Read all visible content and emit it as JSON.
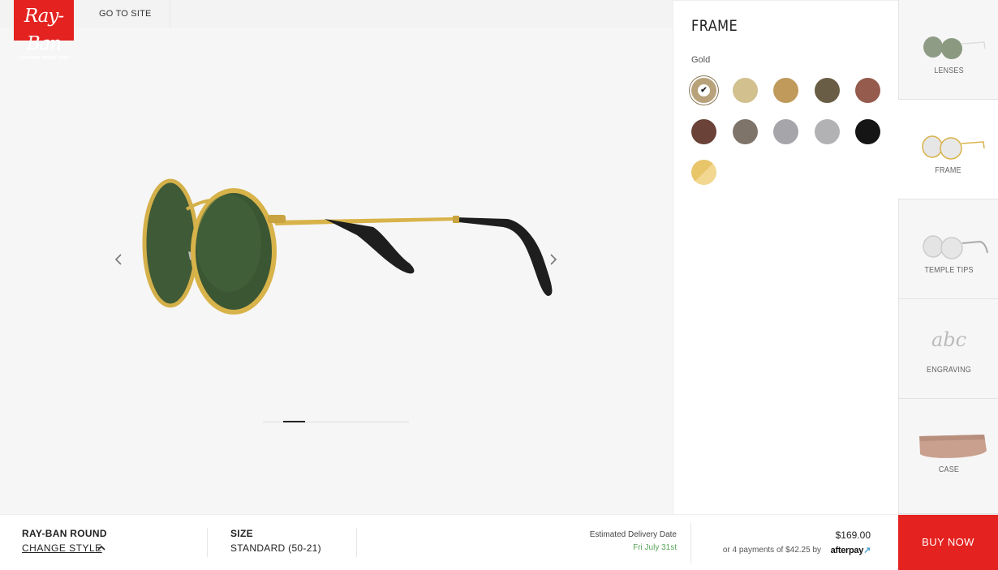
{
  "header": {
    "logo_text": "Ray-Ban",
    "logo_tagline": "GENUINE SINCE 1937",
    "go_to_site": "GO TO SITE"
  },
  "viewer": {
    "carousel_active_index": 1
  },
  "panel": {
    "title": "FRAME",
    "selected_color": "Gold",
    "swatches": [
      {
        "color": "#b8a27a",
        "selected": true
      },
      {
        "color": "#d2c08f"
      },
      {
        "color": "#bf9a5b"
      },
      {
        "color": "#6a5d46"
      },
      {
        "color": "#955b4d"
      },
      {
        "color": "#6a4238"
      },
      {
        "color": "#7f746a"
      },
      {
        "color": "#a5a5aa"
      },
      {
        "color": "#b2b2b4"
      },
      {
        "color": "#151515"
      },
      {
        "color": "#e9c56a"
      }
    ]
  },
  "tabs": [
    {
      "label": "LENSES",
      "icon": "lenses-icon"
    },
    {
      "label": "FRAME",
      "icon": "frame-icon",
      "active": true
    },
    {
      "label": "TEMPLE TIPS",
      "icon": "temple-tips-icon"
    },
    {
      "label": "ENGRAVING",
      "icon": "engraving-icon",
      "icon_text": "abc"
    },
    {
      "label": "CASE",
      "icon": "case-icon"
    }
  ],
  "bottom": {
    "model_name": "RAY-BAN ROUND",
    "change_style": "CHANGE STYLE",
    "size_label": "SIZE",
    "size_value": "STANDARD (50-21)",
    "delivery_label": "Estimated Delivery Date",
    "delivery_date": "Fri July 31st",
    "price": "$169.00",
    "installments": "or 4 payments of $42.25 by",
    "afterpay": "afterpay",
    "buy_now": "BUY NOW"
  }
}
